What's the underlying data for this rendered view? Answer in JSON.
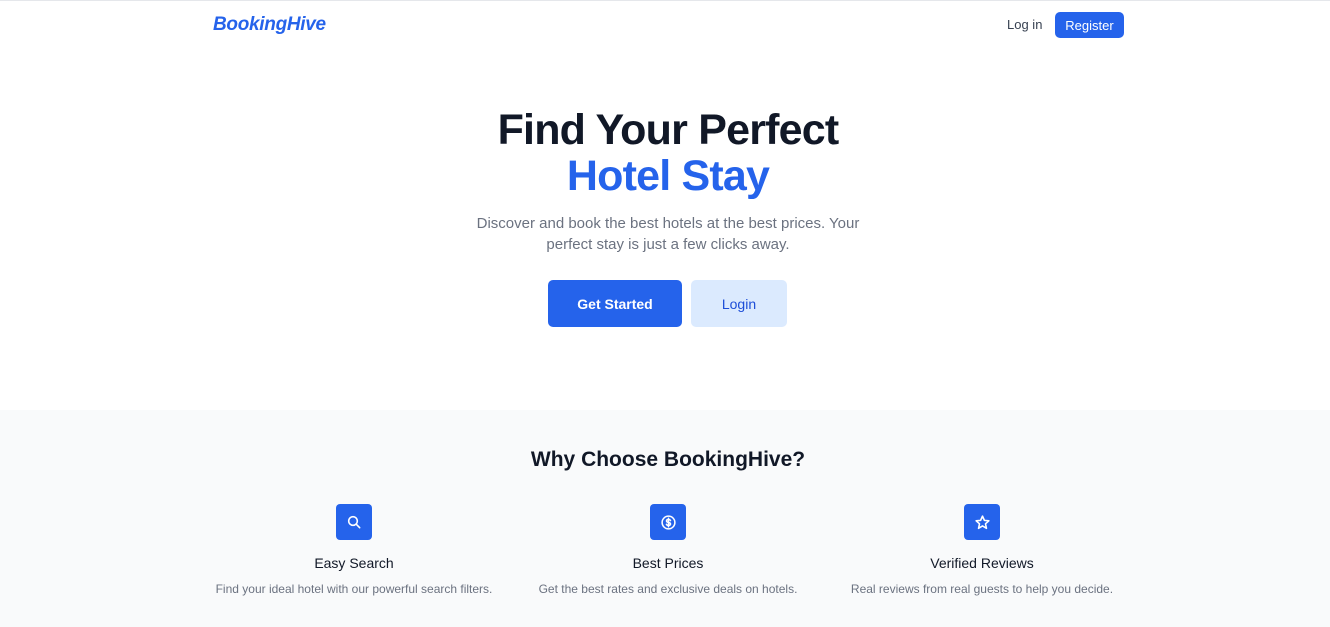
{
  "nav": {
    "brand": "BookingHive",
    "login_label": "Log in",
    "register_label": "Register"
  },
  "hero": {
    "title_line1": "Find Your Perfect",
    "title_line2": "Hotel Stay",
    "subtitle": "Discover and book the best hotels at the best prices. Your perfect stay is just a few clicks away.",
    "primary_button": "Get Started",
    "secondary_button": "Login"
  },
  "features": {
    "title": "Why Choose BookingHive?",
    "items": [
      {
        "icon": "search-icon",
        "title": "Easy Search",
        "description": "Find your ideal hotel with our powerful search filters."
      },
      {
        "icon": "dollar-icon",
        "title": "Best Prices",
        "description": "Get the best rates and exclusive deals on hotels."
      },
      {
        "icon": "star-icon",
        "title": "Verified Reviews",
        "description": "Real reviews from real guests to help you decide."
      }
    ]
  },
  "colors": {
    "accent": "#2563eb",
    "accent_light": "#dbeafe",
    "text_dark": "#111827",
    "text_muted": "#6b7280",
    "section_bg": "#f9fafb"
  }
}
